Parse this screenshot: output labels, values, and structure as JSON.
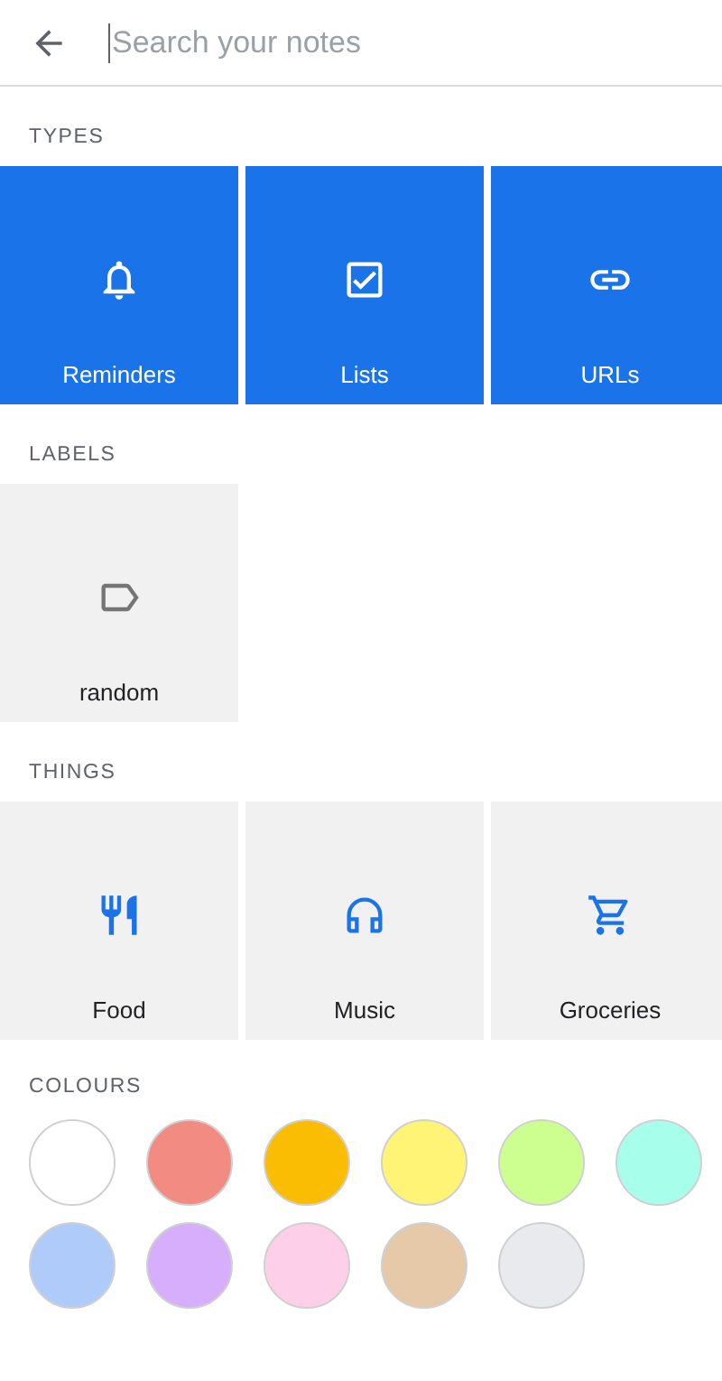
{
  "search": {
    "placeholder": "Search your notes"
  },
  "sections": [
    {
      "title": "TYPES",
      "kind": "types",
      "items": [
        {
          "label": "Reminders",
          "kind": "bell"
        },
        {
          "label": "Lists",
          "kind": "checkbox"
        },
        {
          "label": "URLs",
          "kind": "link"
        }
      ]
    },
    {
      "title": "LABELS",
      "kind": "labels",
      "items": [
        {
          "label": "random",
          "kind": "label"
        }
      ]
    },
    {
      "title": "THINGS",
      "kind": "things",
      "items": [
        {
          "label": "Food",
          "kind": "food"
        },
        {
          "label": "Music",
          "kind": "music"
        },
        {
          "label": "Groceries",
          "kind": "cart"
        }
      ]
    }
  ],
  "colours": {
    "title": "COLOURS",
    "items": [
      {
        "color": "#ffffff"
      },
      {
        "color": "#f28b82"
      },
      {
        "color": "#fbbc04"
      },
      {
        "color": "#fff475"
      },
      {
        "color": "#ccff90"
      },
      {
        "color": "#a7ffeb"
      },
      {
        "color": "#aecbfa"
      },
      {
        "color": "#d7aefb"
      },
      {
        "color": "#fdcfe8"
      },
      {
        "color": "#e6c9a8"
      },
      {
        "color": "#e8eaed"
      }
    ]
  }
}
